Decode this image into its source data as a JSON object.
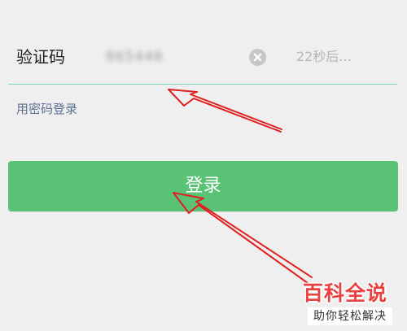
{
  "form": {
    "code_label": "验证码",
    "code_value": "865446",
    "countdown": "22秒后...",
    "password_login_link": "用密码登录",
    "login_button": "登录"
  },
  "icons": {
    "clear": "clear-icon"
  },
  "colors": {
    "background": "#efefef",
    "underline": "#7fd1b4",
    "login_button": "#5ac274",
    "link": "#5e6f91",
    "annotation_arrow": "#e02020"
  },
  "watermark": {
    "main": "百科全说",
    "sub": "助你轻松解决"
  }
}
